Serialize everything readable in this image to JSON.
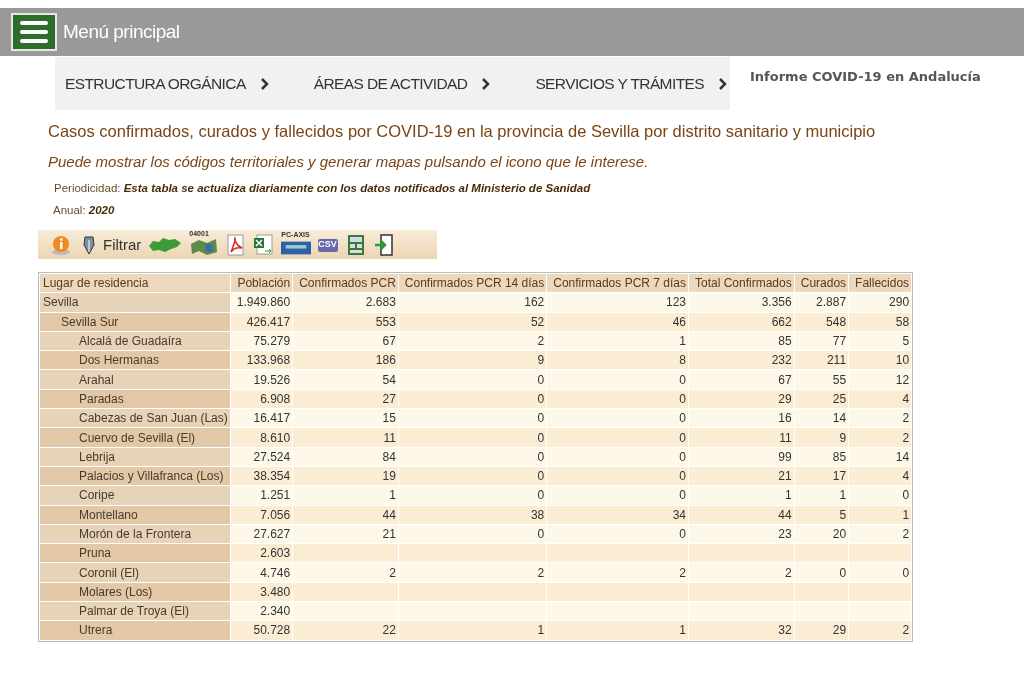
{
  "top_bar": {
    "menu_label": "Menú principal"
  },
  "nav": {
    "items": [
      "ESTRUCTURA ORGÁNICA",
      "ÁREAS DE ACTIVIDAD",
      "SERVICIOS Y TRÁMITES"
    ],
    "section_title": "Informe COVID-19 en Andalucía"
  },
  "title": "Casos confirmados, curados y fallecidos por COVID-19 en la provincia de Sevilla por distrito sanitario y municipio",
  "subtitle": "Puede mostrar los códigos territoriales y generar mapas pulsando el icono que le interese.",
  "meta": [
    {
      "label": "Periodicidad:",
      "value": "Esta tabla se actualiza diariamente con los datos notificados al Ministerio de Sanidad"
    },
    {
      "label": "Anual:",
      "value": "2020"
    }
  ],
  "toolbar": [
    {
      "kind": "info"
    },
    {
      "kind": "filter",
      "label": "Filtrar"
    },
    {
      "kind": "region-map"
    },
    {
      "kind": "codes-map",
      "label": "04001"
    },
    {
      "kind": "pdf"
    },
    {
      "kind": "excel"
    },
    {
      "kind": "pcaxis",
      "label": "PC-AXIS"
    },
    {
      "kind": "csv",
      "label": "CSV"
    },
    {
      "kind": "calc"
    },
    {
      "kind": "exit"
    }
  ],
  "table": {
    "columns": [
      "Lugar de residencia",
      "Población",
      "Confirmados PCR",
      "Confirmados PCR 14 días",
      "Confirmados PCR 7 días",
      "Total Confirmados",
      "Curados",
      "Fallecidos"
    ],
    "rows": [
      {
        "name": "Sevilla",
        "values": [
          "1.949.860",
          "2.683",
          "162",
          "123",
          "3.356",
          "2.887",
          "290"
        ],
        "children": [
          {
            "name": "Sevilla Sur",
            "values": [
              "426.417",
              "553",
              "52",
              "46",
              "662",
              "548",
              "58"
            ],
            "children": [
              {
                "name": "Alcalá de Guadaíra",
                "values": [
                  "75.279",
                  "67",
                  "2",
                  "1",
                  "85",
                  "77",
                  "5"
                ]
              },
              {
                "name": "Dos Hermanas",
                "values": [
                  "133.968",
                  "186",
                  "9",
                  "8",
                  "232",
                  "211",
                  "10"
                ]
              },
              {
                "name": "Arahal",
                "values": [
                  "19.526",
                  "54",
                  "0",
                  "0",
                  "67",
                  "55",
                  "12"
                ]
              },
              {
                "name": "Paradas",
                "values": [
                  "6.908",
                  "27",
                  "0",
                  "0",
                  "29",
                  "25",
                  "4"
                ]
              },
              {
                "name": "Cabezas de San Juan (Las)",
                "values": [
                  "16.417",
                  "15",
                  "0",
                  "0",
                  "16",
                  "14",
                  "2"
                ]
              },
              {
                "name": "Cuervo de Sevilla (El)",
                "values": [
                  "8.610",
                  "11",
                  "0",
                  "0",
                  "11",
                  "9",
                  "2"
                ]
              },
              {
                "name": "Lebrija",
                "values": [
                  "27.524",
                  "84",
                  "0",
                  "0",
                  "99",
                  "85",
                  "14"
                ]
              },
              {
                "name": "Palacios y Villafranca (Los)",
                "values": [
                  "38.354",
                  "19",
                  "0",
                  "0",
                  "21",
                  "17",
                  "4"
                ]
              },
              {
                "name": "Coripe",
                "values": [
                  "1.251",
                  "1",
                  "0",
                  "0",
                  "1",
                  "1",
                  "0"
                ]
              },
              {
                "name": "Montellano",
                "values": [
                  "7.056",
                  "44",
                  "38",
                  "34",
                  "44",
                  "5",
                  "1"
                ]
              },
              {
                "name": "Morón de la Frontera",
                "values": [
                  "27.627",
                  "21",
                  "0",
                  "0",
                  "23",
                  "20",
                  "2"
                ]
              },
              {
                "name": "Pruna",
                "values": [
                  "2.603"
                ]
              },
              {
                "name": "Coronil (El)",
                "values": [
                  "4.746",
                  "2",
                  "2",
                  "2",
                  "2",
                  "0",
                  "0"
                ]
              },
              {
                "name": "Molares (Los)",
                "values": [
                  "3.480"
                ]
              },
              {
                "name": "Palmar de Troya (El)",
                "values": [
                  "2.340"
                ]
              },
              {
                "name": "Utrera",
                "values": [
                  "50.728",
                  "22",
                  "1",
                  "1",
                  "32",
                  "29",
                  "2"
                ]
              }
            ]
          }
        ]
      }
    ]
  }
}
